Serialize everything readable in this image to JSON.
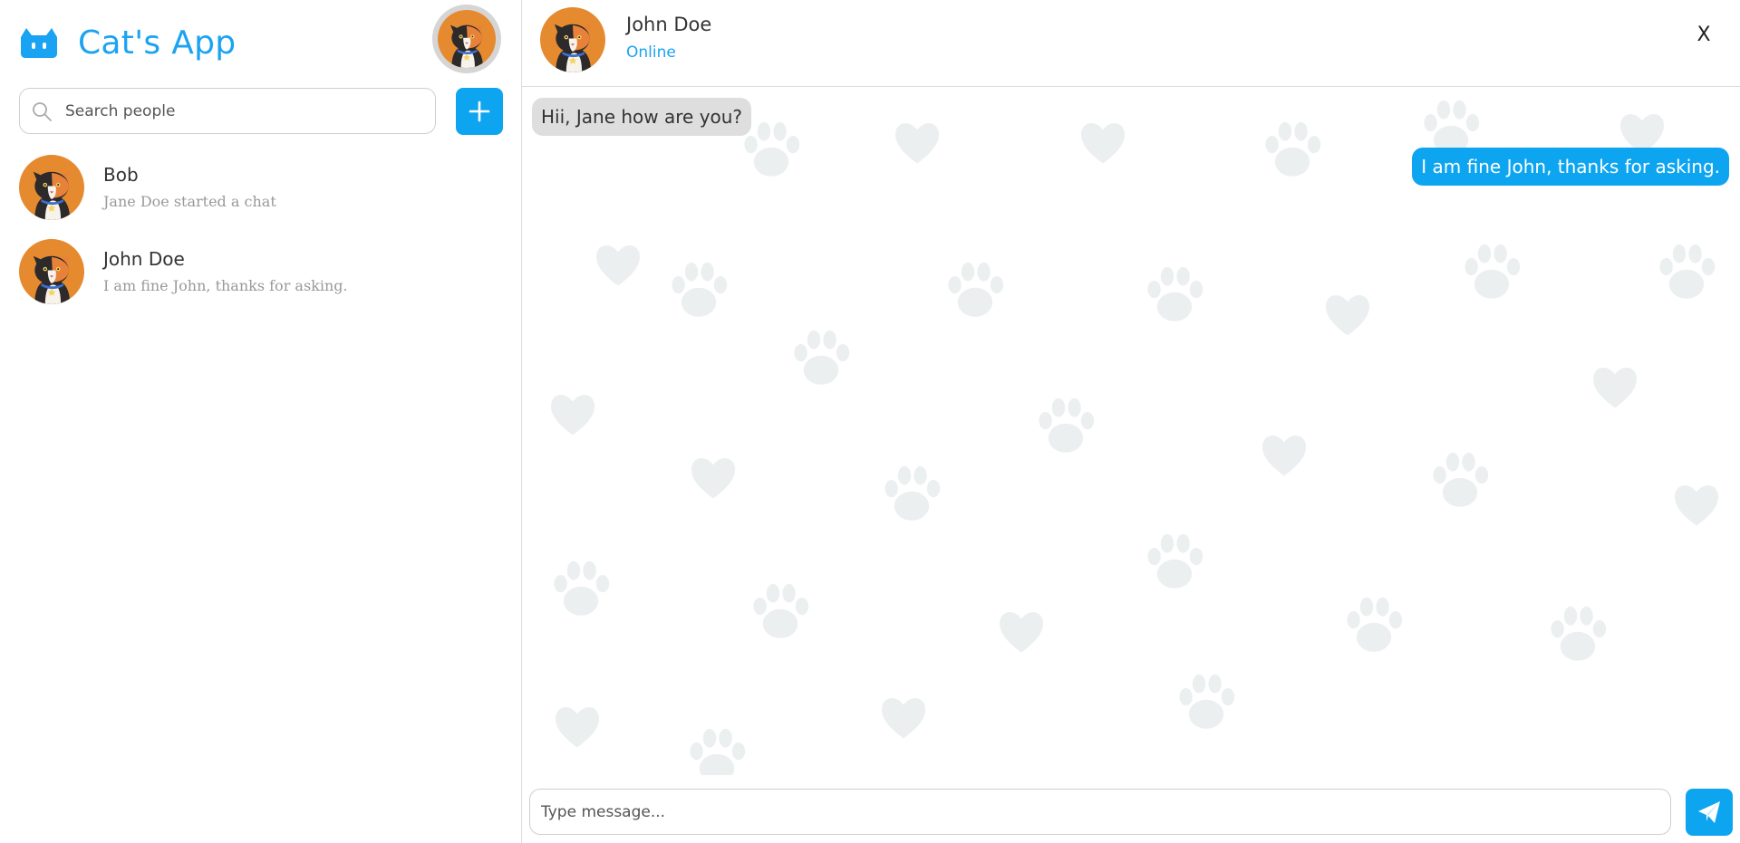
{
  "app": {
    "title": "Cat's App",
    "accent_color": "#0ea5f0",
    "logo_icon": "cat-face-icon"
  },
  "sidebar": {
    "search": {
      "placeholder": "Search people",
      "value": ""
    },
    "add_button_icon": "plus-icon",
    "contacts": [
      {
        "name": "Bob",
        "preview": "Jane Doe started a chat",
        "avatar": "cat-avatar"
      },
      {
        "name": "John Doe",
        "preview": "I am fine John, thanks for asking.",
        "avatar": "cat-avatar"
      }
    ]
  },
  "chat": {
    "peer": {
      "name": "John Doe",
      "status": "Online"
    },
    "close_label": "X",
    "messages": [
      {
        "direction": "in",
        "text": "Hii, Jane how are you?"
      },
      {
        "direction": "out",
        "text": "I am fine John, thanks for asking."
      }
    ],
    "composer": {
      "placeholder": "Type message...",
      "value": ""
    },
    "send_icon": "paper-plane-icon"
  }
}
